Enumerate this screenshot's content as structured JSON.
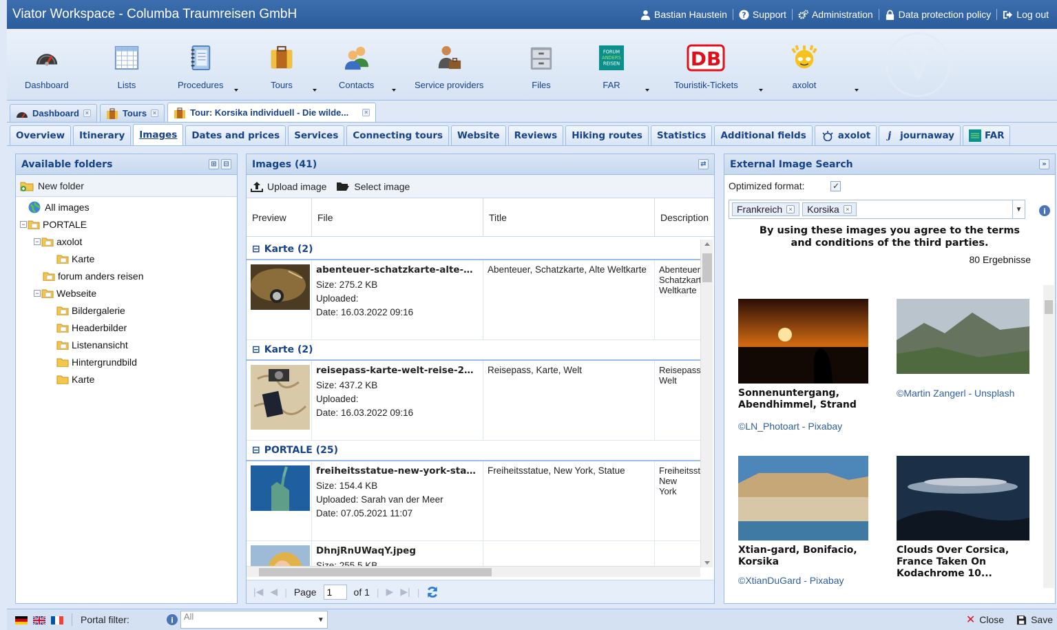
{
  "app_title": "Viator Workspace - Columba Traumreisen GmbH",
  "topnav": {
    "user": "Bastian Haustein",
    "support": "Support",
    "administration": "Administration",
    "data_protection": "Data protection policy",
    "logout": "Log out"
  },
  "toolbar": {
    "dashboard": "Dashboard",
    "lists": "Lists",
    "procedures": "Procedures",
    "tours": "Tours",
    "contacts": "Contacts",
    "service_providers": "Service providers",
    "files": "Files",
    "far": "FAR",
    "touristik_tickets": "Touristik-Tickets",
    "axolot": "axolot",
    "far_logo_text": "FORUM ANDERS REISEN",
    "db_logo_text": "DB"
  },
  "doc_tabs": [
    {
      "label": "Dashboard"
    },
    {
      "label": "Tours"
    },
    {
      "label": "Tour: Korsika individuell - Die wilde..."
    }
  ],
  "sub_tabs": [
    {
      "label": "Overview"
    },
    {
      "label": "Itinerary"
    },
    {
      "label": "Images"
    },
    {
      "label": "Dates and prices"
    },
    {
      "label": "Services"
    },
    {
      "label": "Connecting tours"
    },
    {
      "label": "Website"
    },
    {
      "label": "Reviews"
    },
    {
      "label": "Hiking routes"
    },
    {
      "label": "Statistics"
    },
    {
      "label": "Additional fields"
    },
    {
      "label": "axolot"
    },
    {
      "label": "journaway"
    },
    {
      "label": "FAR"
    }
  ],
  "folders_panel": {
    "title": "Available folders",
    "new_folder": "New folder",
    "tree": [
      {
        "label": "All images"
      },
      {
        "label": "PORTALE"
      },
      {
        "label": "axolot"
      },
      {
        "label": "Karte"
      },
      {
        "label": "forum anders reisen"
      },
      {
        "label": "Webseite"
      },
      {
        "label": "Bildergalerie"
      },
      {
        "label": "Headerbilder"
      },
      {
        "label": "Listenansicht"
      },
      {
        "label": "Hintergrundbild"
      },
      {
        "label": "Karte"
      }
    ]
  },
  "images_panel": {
    "title": "Images (41)",
    "upload": "Upload image",
    "select": "Select image",
    "columns": {
      "preview": "Preview",
      "file": "File",
      "title": "Title",
      "description": "Description"
    },
    "groups": [
      {
        "label": "Karte (2)",
        "file": "abenteuer-schatzkarte-alte-wel...",
        "size": "Size: 275.2 KB",
        "uploaded": "Uploaded:",
        "date": "Date: 16.03.2022 09:16",
        "title": "Abenteuer, Schatzkarte, Alte Weltkarte",
        "description": "Abenteuer, Schatzkarte, Weltkarte"
      },
      {
        "label": "Karte (2)",
        "file": "reisepass-karte-welt-reise-271...",
        "size": "Size: 437.2 KB",
        "uploaded": "Uploaded:",
        "date": "Date: 16.03.2022 09:16",
        "title": "Reisepass, Karte, Welt",
        "description": "Reisepass, Welt"
      },
      {
        "label": "PORTALE (25)",
        "file": "freiheitsstatue-new-york-statue...",
        "size": "Size: 154.4 KB",
        "uploaded": "Uploaded: Sarah van der Meer",
        "date": "Date: 07.05.2021 11:07",
        "title": "Freiheitsstatue, New York, Statue",
        "description": "Freiheitsstatue, New York"
      }
    ],
    "partial_row": {
      "file": "DhnjRnUWaqY.jpeg",
      "size": "Size: 255.5 KB"
    },
    "pager": {
      "page_label": "Page",
      "page": "1",
      "of": "of 1"
    }
  },
  "external_panel": {
    "title": "External Image Search",
    "optimized_label": "Optimized format:",
    "tags": [
      "Frankreich",
      "Korsika"
    ],
    "notice": "By using these images you agree to the terms and conditions of the third parties.",
    "results": "80 Ergebnisse",
    "cards": [
      {
        "caption": "Sonnenuntergang, Abendhimmel, Strand",
        "credit": "©LN_Photoart - Pixabay"
      },
      {
        "caption": "",
        "credit": "©Martin Zangerl - Unsplash"
      },
      {
        "caption": "Xtian-gard, Bonifacio, Korsika",
        "credit": "©XtianDuGard - Pixabay"
      },
      {
        "caption": "Clouds Over Corsica, France Taken On Kodachrome 10...",
        "credit": ""
      }
    ]
  },
  "bottombar": {
    "portal_filter_label": "Portal filter:",
    "portal_filter_value": "All",
    "close": "Close",
    "save": "Save"
  }
}
